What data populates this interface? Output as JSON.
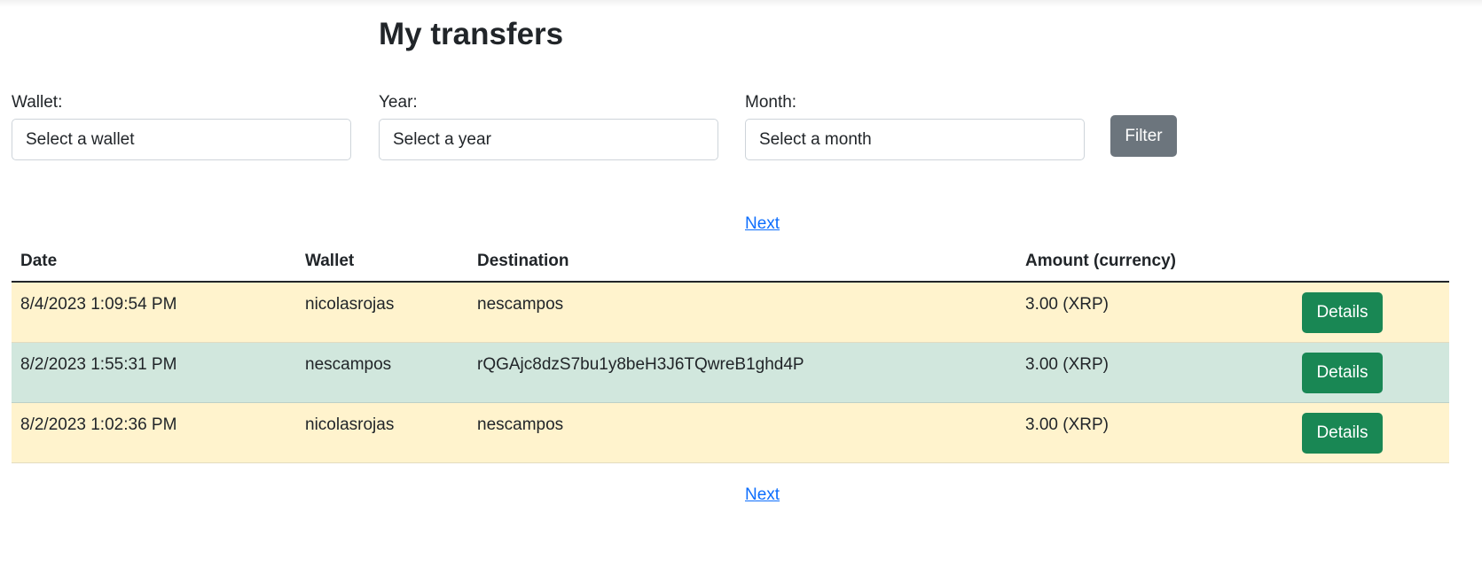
{
  "page": {
    "title": "My transfers"
  },
  "filters": {
    "wallet": {
      "label": "Wallet:",
      "placeholder": "Select a wallet"
    },
    "year": {
      "label": "Year:",
      "placeholder": "Select a year"
    },
    "month": {
      "label": "Month:",
      "placeholder": "Select a month"
    },
    "filter_button": "Filter"
  },
  "pagination": {
    "next_label": "Next"
  },
  "table": {
    "headers": {
      "date": "Date",
      "wallet": "Wallet",
      "destination": "Destination",
      "amount": "Amount (currency)"
    },
    "rows": [
      {
        "date": "8/4/2023 1:09:54 PM",
        "wallet": "nicolasrojas",
        "destination": "nescampos",
        "amount": "3.00 (XRP)",
        "action": "Details"
      },
      {
        "date": "8/2/2023 1:55:31 PM",
        "wallet": "nescampos",
        "destination": "rQGAjc8dzS7bu1y8beH3J6TQwreB1ghd4P",
        "amount": "3.00 (XRP)",
        "action": "Details"
      },
      {
        "date": "8/2/2023 1:02:36 PM",
        "wallet": "nicolasrojas",
        "destination": "nescampos",
        "amount": "3.00 (XRP)",
        "action": "Details"
      }
    ]
  },
  "colors": {
    "incoming_row": "#fff3cd",
    "outgoing_row": "#d1e7dd",
    "details_button": "#198754",
    "filter_button": "#6c757d",
    "link": "#0d6efd"
  }
}
